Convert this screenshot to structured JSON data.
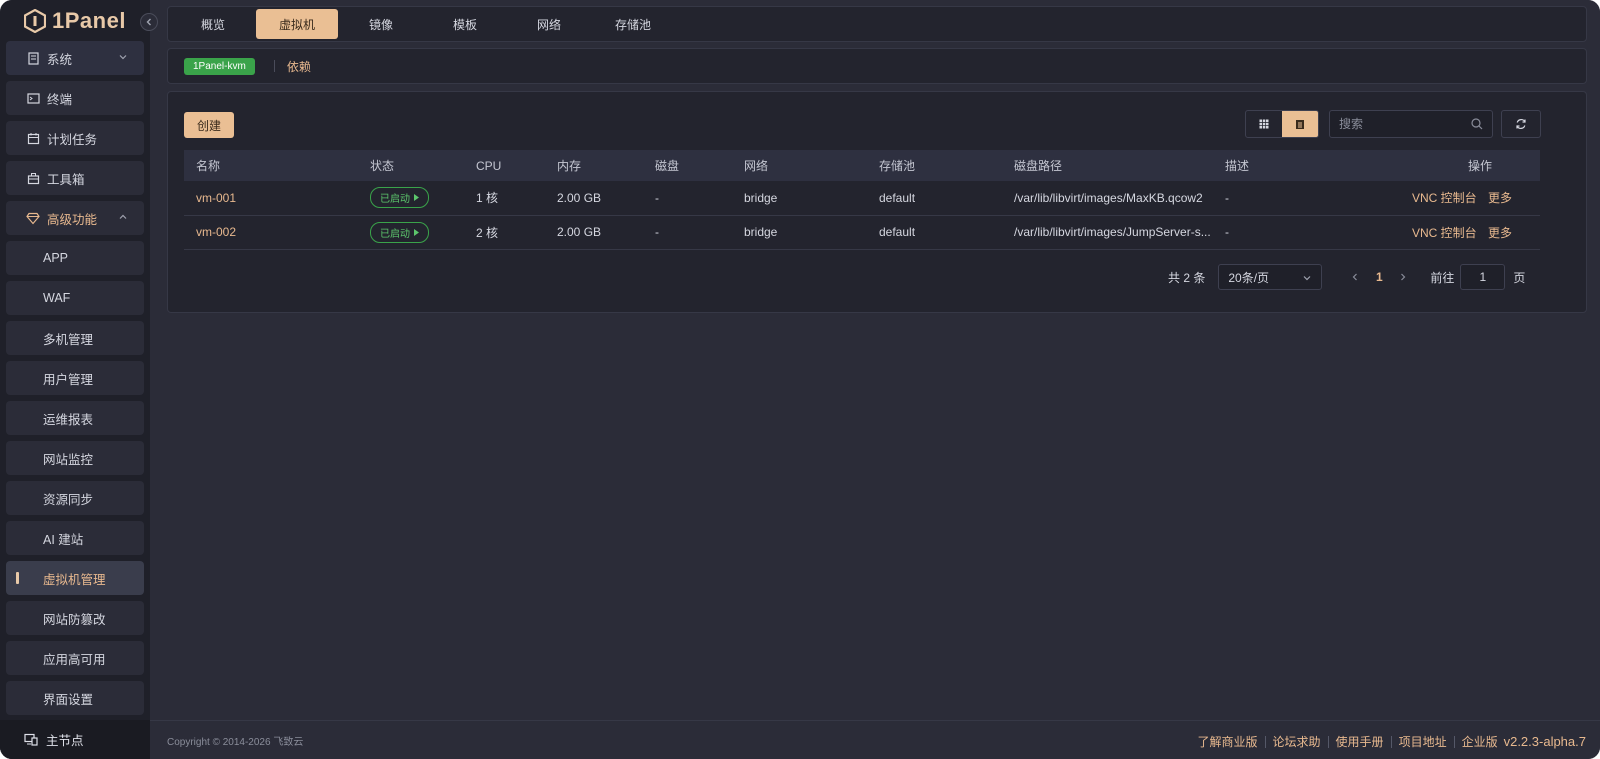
{
  "brand": {
    "name": "1Panel"
  },
  "sidebar": {
    "items": [
      {
        "label": "系统",
        "icon": "server-icon"
      },
      {
        "label": "终端",
        "icon": "terminal-icon"
      },
      {
        "label": "计划任务",
        "icon": "calendar-icon"
      },
      {
        "label": "工具箱",
        "icon": "toolbox-icon"
      },
      {
        "label": "高级功能",
        "icon": "diamond-icon"
      },
      {
        "label": "APP"
      },
      {
        "label": "WAF"
      },
      {
        "label": "多机管理"
      },
      {
        "label": "用户管理"
      },
      {
        "label": "运维报表"
      },
      {
        "label": "网站监控"
      },
      {
        "label": "资源同步"
      },
      {
        "label": "AI 建站"
      },
      {
        "label": "虚拟机管理"
      },
      {
        "label": "网站防篡改"
      },
      {
        "label": "应用高可用"
      },
      {
        "label": "界面设置"
      }
    ],
    "footer": {
      "label": "主节点"
    }
  },
  "tabs": [
    "概览",
    "虚拟机",
    "镜像",
    "模板",
    "网络",
    "存储池"
  ],
  "subbar": {
    "tag": "1Panel-kvm",
    "link": "依赖"
  },
  "toolbar": {
    "create_label": "创建",
    "search_placeholder": "搜索"
  },
  "table": {
    "headers": [
      "名称",
      "状态",
      "CPU",
      "内存",
      "磁盘",
      "网络",
      "存储池",
      "磁盘路径",
      "描述",
      "操作"
    ],
    "rows": [
      {
        "name": "vm-001",
        "status": "已启动",
        "cpu": "1 核",
        "memory": "2.00 GB",
        "disk": "-",
        "network": "bridge",
        "pool": "default",
        "path": "/var/lib/libvirt/images/MaxKB.qcow2",
        "desc": "-"
      },
      {
        "name": "vm-002",
        "status": "已启动",
        "cpu": "2 核",
        "memory": "2.00 GB",
        "disk": "-",
        "network": "bridge",
        "pool": "default",
        "path": "/var/lib/libvirt/images/JumpServer-s...",
        "desc": "-"
      }
    ],
    "ops": {
      "vnc": "VNC",
      "console": "控制台",
      "more": "更多"
    }
  },
  "pagination": {
    "total": "共 2 条",
    "page_size": "20条/页",
    "current": "1",
    "goto": "前往",
    "goto_value": "1",
    "page_unit": "页"
  },
  "footer": {
    "copyright": "Copyright © 2014-2026 飞致云",
    "links": [
      "了解商业版",
      "论坛求助",
      "使用手册",
      "项目地址",
      "企业版"
    ],
    "version": "v2.2.3-alpha.7"
  },
  "colors": {
    "accent": "#eabf94",
    "success": "#3aa34a",
    "bg": "#2b2c38",
    "sidebar": "#1f2029"
  }
}
